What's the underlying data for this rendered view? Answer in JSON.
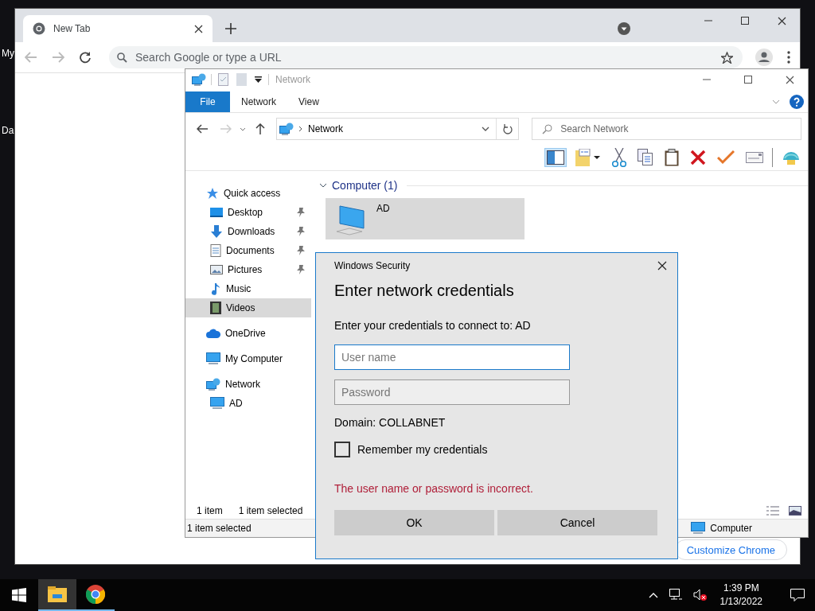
{
  "desktop": {
    "icons": [
      {
        "label": "My"
      },
      {
        "label": "Da"
      }
    ]
  },
  "browser": {
    "tabs": [
      {
        "title": "New Tab",
        "selected": true
      }
    ],
    "omnibox": {
      "placeholder": "Search Google or type a URL"
    },
    "customize_button": "Customize Chrome"
  },
  "explorer": {
    "title": "Network",
    "ribbon_tabs": [
      {
        "label": "File",
        "selected": true
      },
      {
        "label": "Network",
        "selected": false
      },
      {
        "label": "View",
        "selected": false
      }
    ],
    "address": {
      "path": "Network"
    },
    "search": {
      "placeholder": "Search Network"
    },
    "nav": [
      {
        "label": "Quick access",
        "kind": "star",
        "selected": false,
        "children": [
          {
            "label": "Desktop",
            "kind": "desktop",
            "pinned": true,
            "selected": false
          },
          {
            "label": "Downloads",
            "kind": "downloads",
            "pinned": true,
            "selected": false
          },
          {
            "label": "Documents",
            "kind": "documents",
            "pinned": true,
            "selected": false
          },
          {
            "label": "Pictures",
            "kind": "pictures",
            "pinned": true,
            "selected": false
          },
          {
            "label": "Music",
            "kind": "music",
            "pinned": false,
            "selected": false
          },
          {
            "label": "Videos",
            "kind": "videos",
            "pinned": false,
            "selected": true
          }
        ]
      },
      {
        "label": "OneDrive",
        "kind": "cloud",
        "selected": false
      },
      {
        "label": "My Computer",
        "kind": "computer",
        "selected": false
      },
      {
        "label": "Network",
        "kind": "network",
        "selected": false,
        "children": [
          {
            "label": "AD",
            "kind": "computer",
            "pinned": false,
            "selected": false
          }
        ]
      }
    ],
    "group": {
      "label": "Computer (1)",
      "expanded": true,
      "items": [
        {
          "label": "AD",
          "selected": true
        }
      ]
    },
    "status_bar": {
      "count": "1 item",
      "selection": "1 item selected"
    },
    "details_bar": {
      "selection": "1 item selected",
      "type": "Computer"
    }
  },
  "dialog": {
    "title": "Windows Security",
    "heading": "Enter network credentials",
    "prompt": "Enter your credentials to connect to: AD",
    "fields": [
      {
        "placeholder": "User name",
        "focused": true
      },
      {
        "placeholder": "Password",
        "focused": false
      }
    ],
    "domain": "Domain: COLLABNET",
    "remember": {
      "label": "Remember my credentials",
      "checked": false
    },
    "error": "The user name or password is incorrect.",
    "buttons": [
      "OK",
      "Cancel"
    ]
  },
  "taskbar": {
    "apps": [
      {
        "kind": "explorer",
        "selected": true
      },
      {
        "kind": "chrome",
        "selected": false
      }
    ],
    "time": "1:39 PM",
    "date": "1/13/2022"
  }
}
